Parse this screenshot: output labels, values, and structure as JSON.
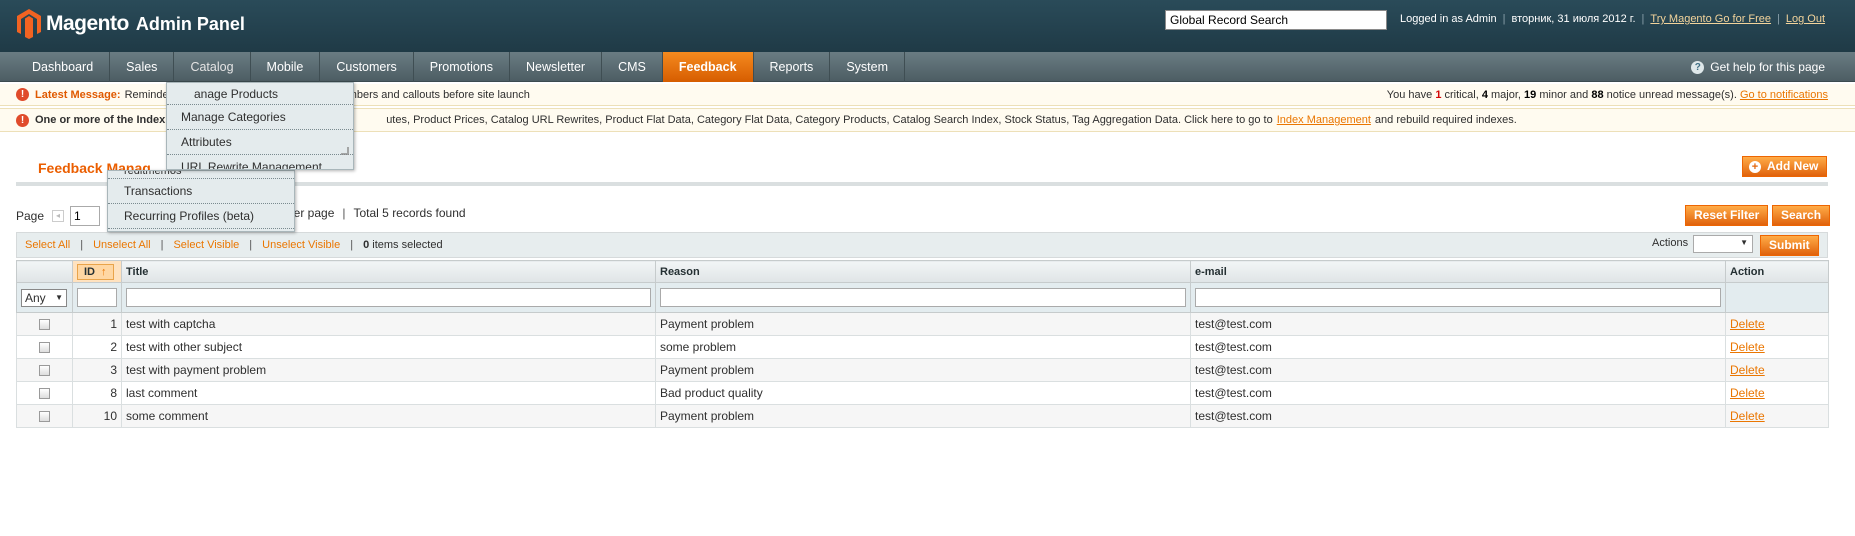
{
  "app": {
    "logo_text": "Magento",
    "logo_sub": "Admin Panel"
  },
  "header": {
    "search_value": "Global Record Search",
    "logged_in": "Logged in as Admin",
    "date": "вторник, 31 июля 2012 г.",
    "try_go": "Try Magento Go for Free",
    "logout": "Log Out"
  },
  "nav": {
    "items": [
      {
        "label": "Dashboard"
      },
      {
        "label": "Sales"
      },
      {
        "label": "Catalog"
      },
      {
        "label": "Mobile"
      },
      {
        "label": "Customers"
      },
      {
        "label": "Promotions"
      },
      {
        "label": "Newsletter"
      },
      {
        "label": "CMS"
      },
      {
        "label": "Feedback"
      },
      {
        "label": "Reports"
      },
      {
        "label": "System"
      }
    ],
    "help": "Get help for this page"
  },
  "messages": {
    "latest_label": "Latest Message:",
    "latest_text_a": "Reminder: Ch",
    "latest_text_b": "numbers and callouts before site launch",
    "unread_a": "You have",
    "critical_count": "1",
    "critical_label": "critical",
    "major_count": "4",
    "major_label": "major",
    "minor_count": "19",
    "minor_label": "minor and",
    "notice_count": "88",
    "notice_label": "notice unread message(s).",
    "goto": "Go to notifications",
    "index_bold": "One or more of the Index",
    "index_text": "utes, Product Prices, Catalog URL Rewrites, Product Flat Data, Category Flat Data, Category Products, Catalog Search Index, Stock Status, Tag Aggregation Data. Click here to go to",
    "index_link": "Index Management",
    "index_tail": "and rebuild required indexes."
  },
  "page": {
    "title": "Feedback Manag",
    "add_new": "Add New",
    "reset_filter": "Reset Filter",
    "search": "Search"
  },
  "pager": {
    "page_label": "Page",
    "page_value": "1",
    "per_page_tail": "per page",
    "total": "Total 5 records found"
  },
  "massaction": {
    "select_all": "Select All",
    "unselect_all": "Unselect All",
    "select_visible": "Select Visible",
    "unselect_visible": "Unselect Visible",
    "selected_count": "0",
    "selected_label": "items selected",
    "actions_label": "Actions",
    "submit": "Submit"
  },
  "grid": {
    "columns": [
      "ID",
      "Title",
      "Reason",
      "e-mail",
      "Action"
    ],
    "any": "Any",
    "rows": [
      {
        "id": "1",
        "title": "test with captcha",
        "reason": "Payment problem",
        "email": "test@test.com",
        "action": "Delete"
      },
      {
        "id": "2",
        "title": "test with other subject",
        "reason": "some problem",
        "email": "test@test.com",
        "action": "Delete"
      },
      {
        "id": "3",
        "title": "test with payment problem",
        "reason": "Payment problem",
        "email": "test@test.com",
        "action": "Delete"
      },
      {
        "id": "8",
        "title": "last comment",
        "reason": "Bad product quality",
        "email": "test@test.com",
        "action": "Delete"
      },
      {
        "id": "10",
        "title": "some comment",
        "reason": "Payment problem",
        "email": "test@test.com",
        "action": "Delete"
      }
    ]
  },
  "catalog_menu": {
    "items": [
      {
        "label": "anage Products"
      },
      {
        "label": "Manage Categories"
      },
      {
        "label": "Attributes"
      },
      {
        "label": "URL Rewrite Management"
      }
    ]
  },
  "sales_menu": {
    "items": [
      {
        "label": "reditmemos"
      },
      {
        "label": "Transactions"
      },
      {
        "label": "Recurring Profiles (beta)"
      }
    ]
  },
  "colors": {
    "accent": "#ea7601",
    "header_bg": "#2a4b59",
    "nav_active": "#e86d0e"
  }
}
